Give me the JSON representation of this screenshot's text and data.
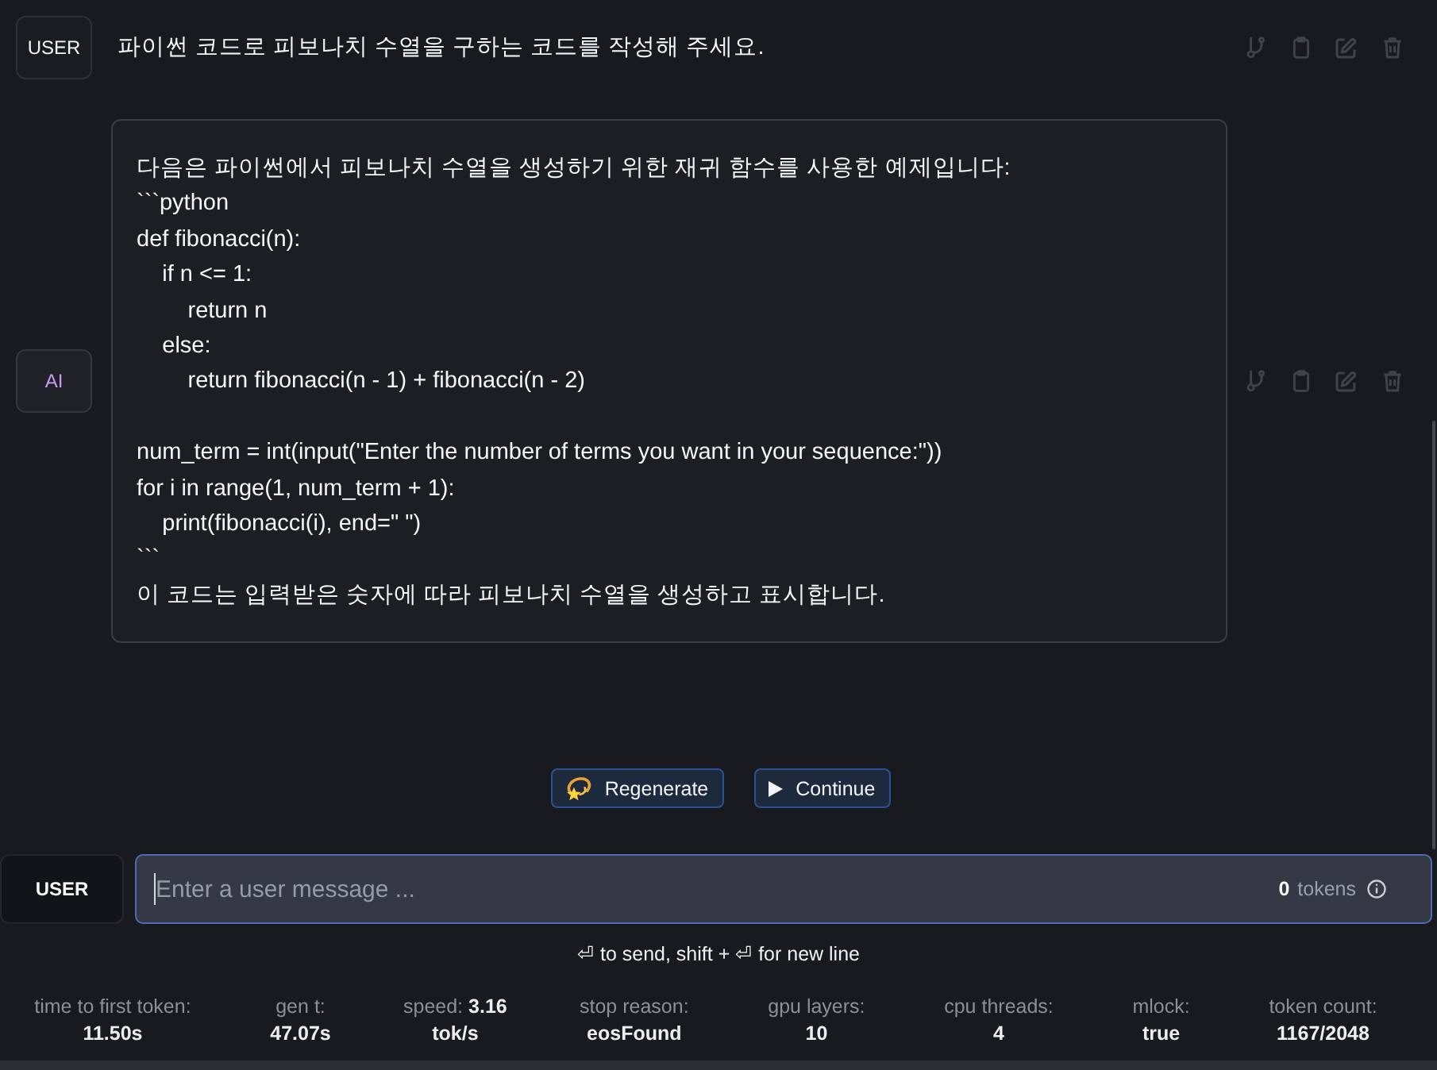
{
  "messages": [
    {
      "kind": "user",
      "role": "USER",
      "text": "파이썬 코드로 피보나치 수열을 구하는 코드를 작성해 주세요."
    },
    {
      "kind": "ai",
      "role": "AI",
      "text": "다음은 파이썬에서 피보나치 수열을 생성하기 위한 재귀 함수를 사용한 예제입니다:\n```python\ndef fibonacci(n):\n    if n <= 1:\n        return n\n    else:\n        return fibonacci(n - 1) + fibonacci(n - 2)\n\nnum_term = int(input(\"Enter the number of terms you want in your sequence:\"))\nfor i in range(1, num_term + 1):\n    print(fibonacci(i), end=\" \")\n```\n이 코드는 입력받은 숫자에 따라 피보나치 수열을 생성하고 표시합니다."
    }
  ],
  "generation_buttons": [
    {
      "kind": "regenerate",
      "label": "Regenerate"
    },
    {
      "kind": "continue",
      "label": "Continue"
    }
  ],
  "composer": {
    "role": "USER",
    "placeholder": "Enter a user message ...",
    "focused": true,
    "token_count": "0",
    "token_unit": "tokens"
  },
  "hint": "⏎ to send, shift + ⏎ for new line",
  "stats": [
    {
      "label": "time to first token:",
      "value": "11.50s"
    },
    {
      "label": "gen t:",
      "value": "47.07s"
    },
    {
      "label": "speed:",
      "value": "3.16 tok/s"
    },
    {
      "label": "stop reason:",
      "value": "eosFound"
    },
    {
      "label": "gpu layers:",
      "value": "10"
    },
    {
      "label": "cpu threads:",
      "value": "4"
    },
    {
      "label": "mlock:",
      "value": "true"
    },
    {
      "label": "token count:",
      "value": "1167/2048"
    }
  ]
}
